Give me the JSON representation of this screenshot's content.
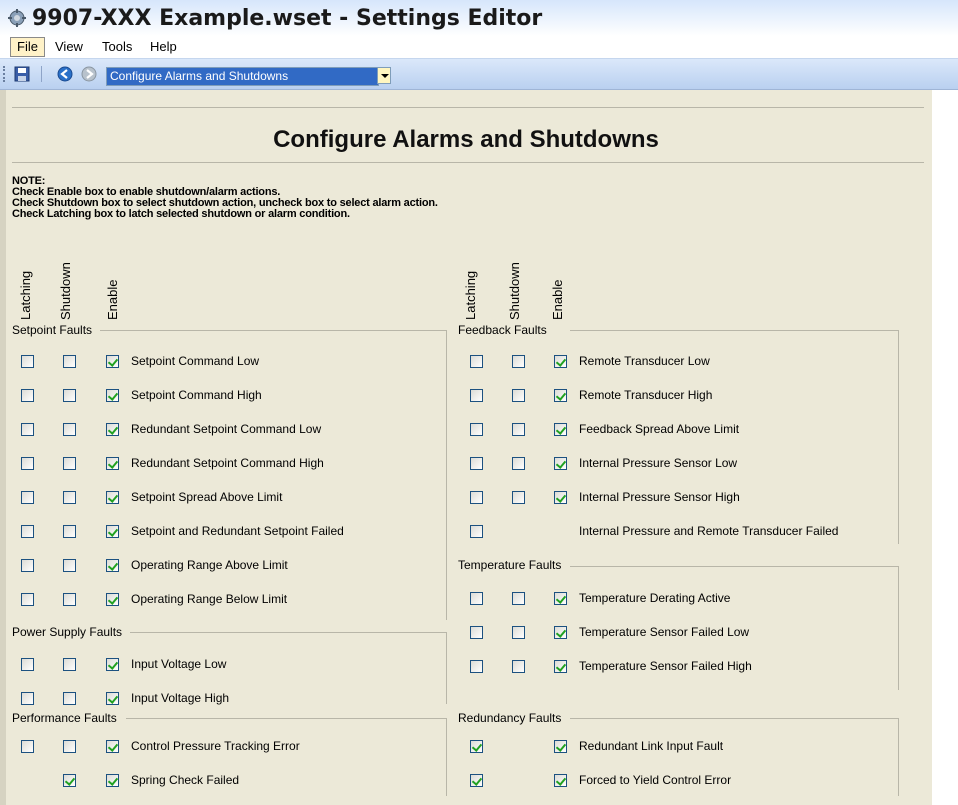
{
  "window": {
    "title": "9907-XXX Example.wset - Settings Editor"
  },
  "menu": [
    {
      "label": "File",
      "active": true
    },
    {
      "label": "View"
    },
    {
      "label": "Tools"
    },
    {
      "label": "Help"
    }
  ],
  "toolbar": {
    "page_select_value": "Configure  Alarms and Shutdowns"
  },
  "page": {
    "heading": "Configure  Alarms and Shutdowns",
    "note_title": "NOTE:",
    "note_lines": [
      "Check Enable box to enable shutdown/alarm actions.",
      "Check Shutdown box to select shutdown action, uncheck box to select alarm action.",
      "Check Latching box to latch selected shutdown or alarm condition."
    ],
    "columns": [
      "Latching",
      "Shutdown",
      "Enable"
    ]
  },
  "groups": {
    "setpoint": {
      "label": "Setpoint Faults",
      "items": [
        {
          "label": "Setpoint Command Low",
          "latching": false,
          "shutdown": false,
          "enable": true
        },
        {
          "label": "Setpoint Command High",
          "latching": false,
          "shutdown": false,
          "enable": true
        },
        {
          "label": "Redundant Setpoint Command Low",
          "latching": false,
          "shutdown": false,
          "enable": true
        },
        {
          "label": "Redundant Setpoint Command High",
          "latching": false,
          "shutdown": false,
          "enable": true
        },
        {
          "label": "Setpoint Spread Above Limit",
          "latching": false,
          "shutdown": false,
          "enable": true
        },
        {
          "label": "Setpoint and Redundant Setpoint Failed",
          "latching": false,
          "shutdown": false,
          "enable": true
        },
        {
          "label": "Operating Range Above Limit",
          "latching": false,
          "shutdown": false,
          "enable": true
        },
        {
          "label": "Operating Range Below Limit",
          "latching": false,
          "shutdown": false,
          "enable": true
        }
      ]
    },
    "power": {
      "label": "Power Supply Faults",
      "items": [
        {
          "label": "Input Voltage Low",
          "latching": false,
          "shutdown": false,
          "enable": true
        },
        {
          "label": "Input Voltage High",
          "latching": false,
          "shutdown": false,
          "enable": true
        }
      ]
    },
    "performance": {
      "label": "Performance Faults",
      "items": [
        {
          "label": "Control Pressure Tracking Error",
          "latching": false,
          "shutdown": false,
          "enable": true
        },
        {
          "label": "Spring Check Failed",
          "latching": null,
          "shutdown": true,
          "enable": true
        }
      ]
    },
    "feedback": {
      "label": "Feedback Faults",
      "items": [
        {
          "label": "Remote Transducer Low",
          "latching": false,
          "shutdown": false,
          "enable": true
        },
        {
          "label": "Remote Transducer High",
          "latching": false,
          "shutdown": false,
          "enable": true
        },
        {
          "label": "Feedback Spread Above Limit",
          "latching": false,
          "shutdown": false,
          "enable": true
        },
        {
          "label": "Internal Pressure Sensor Low",
          "latching": false,
          "shutdown": false,
          "enable": true
        },
        {
          "label": "Internal Pressure Sensor High",
          "latching": false,
          "shutdown": false,
          "enable": true
        },
        {
          "label": "Internal Pressure and Remote Transducer Failed",
          "latching": false,
          "shutdown": null,
          "enable": null
        }
      ]
    },
    "temperature": {
      "label": "Temperature Faults",
      "items": [
        {
          "label": "Temperature Derating Active",
          "latching": false,
          "shutdown": false,
          "enable": true
        },
        {
          "label": "Temperature Sensor Failed Low",
          "latching": false,
          "shutdown": false,
          "enable": true
        },
        {
          "label": "Temperature Sensor Failed High",
          "latching": false,
          "shutdown": false,
          "enable": true
        }
      ]
    },
    "redundancy": {
      "label": "Redundancy Faults",
      "items": [
        {
          "label": "Redundant Link Input Fault",
          "latching": true,
          "shutdown": null,
          "enable": true
        },
        {
          "label": "Forced to Yield Control Error",
          "latching": true,
          "shutdown": null,
          "enable": true
        }
      ]
    }
  }
}
